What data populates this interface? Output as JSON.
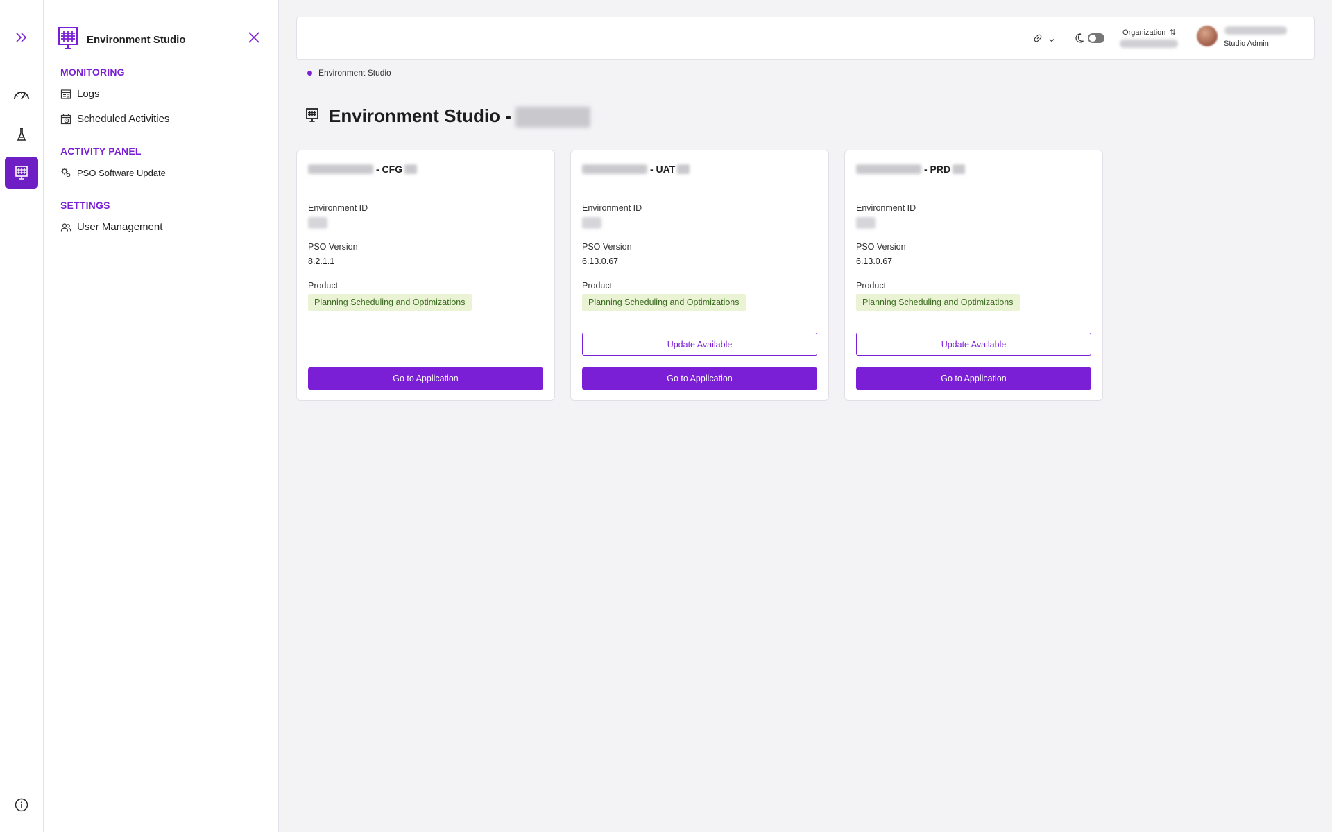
{
  "app": {
    "accent_color": "#7a1fd6",
    "badge_bg": "#eaf4d4",
    "badge_text": "#3c6b22"
  },
  "rail": {
    "items": [
      {
        "icon": "expand-chevrons-icon"
      },
      {
        "icon": "gauge-icon"
      },
      {
        "icon": "flask-icon"
      },
      {
        "icon": "grid-board-icon",
        "active": true
      },
      {
        "icon": "info-icon"
      }
    ]
  },
  "panel": {
    "title": "Environment Studio",
    "sections": [
      {
        "label": "MONITORING",
        "items": [
          {
            "label": "Logs",
            "icon": "logs-icon"
          },
          {
            "label": "Scheduled Activities",
            "icon": "calendar-clock-icon"
          }
        ]
      },
      {
        "label": "ACTIVITY PANEL",
        "items": [
          {
            "label": "PSO Software Update",
            "icon": "gear-cog-icon"
          }
        ]
      },
      {
        "label": "SETTINGS",
        "items": [
          {
            "label": "User Management",
            "icon": "users-icon"
          }
        ]
      }
    ]
  },
  "header": {
    "organization_label": "Organization",
    "user_role": "Studio Admin"
  },
  "breadcrumb": {
    "current": "Environment Studio"
  },
  "page": {
    "title": "Environment Studio -"
  },
  "cards": [
    {
      "suffix": "- CFG",
      "env_id_label": "Environment ID",
      "version_label": "PSO Version",
      "version": "8.2.1.1",
      "product_label": "Product",
      "product": "Planning Scheduling and Optimizations",
      "update_label": "",
      "goto_label": "Go to Application"
    },
    {
      "suffix": "- UAT",
      "env_id_label": "Environment ID",
      "version_label": "PSO Version",
      "version": "6.13.0.67",
      "product_label": "Product",
      "product": "Planning Scheduling and Optimizations",
      "update_label": "Update Available",
      "goto_label": "Go to Application"
    },
    {
      "suffix": "- PRD",
      "env_id_label": "Environment ID",
      "version_label": "PSO Version",
      "version": "6.13.0.67",
      "product_label": "Product",
      "product": "Planning Scheduling and Optimizations",
      "update_label": "Update Available",
      "goto_label": "Go to Application"
    }
  ]
}
